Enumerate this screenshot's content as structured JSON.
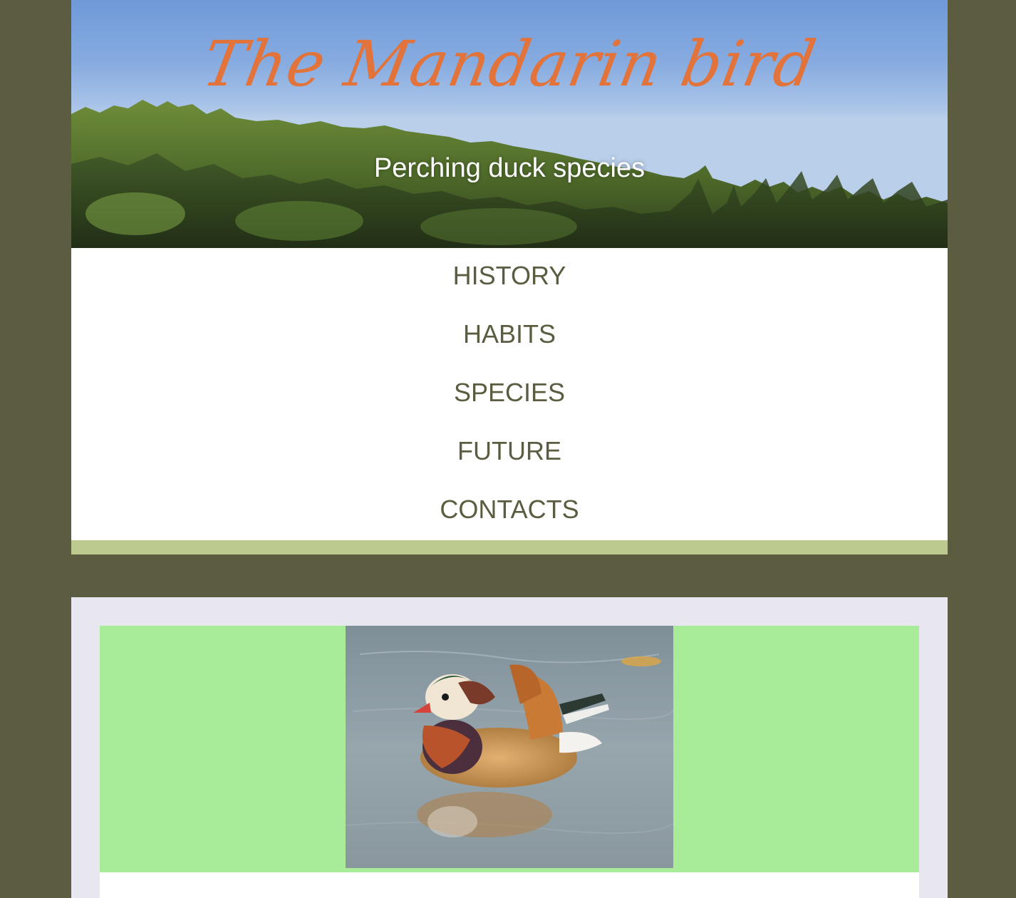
{
  "header": {
    "title": "The Mandarin bird",
    "subtitle": "Perching duck species"
  },
  "nav": {
    "items": [
      {
        "label": "HISTORY"
      },
      {
        "label": "HABITS"
      },
      {
        "label": "SPECIES"
      },
      {
        "label": "FUTURE"
      },
      {
        "label": "CONTACTS"
      }
    ]
  },
  "colors": {
    "page_background": "#5b5c40",
    "title_orange": "#e2733b",
    "nav_text": "#5b5c40",
    "nav_bottom_bar": "#bcc98f",
    "card_background": "#e8e6ee",
    "photo_panel_green": "#a8ec99"
  },
  "images": {
    "banner": "forest-landscape-under-blue-sky",
    "photo": "mandarin-duck-swimming"
  }
}
